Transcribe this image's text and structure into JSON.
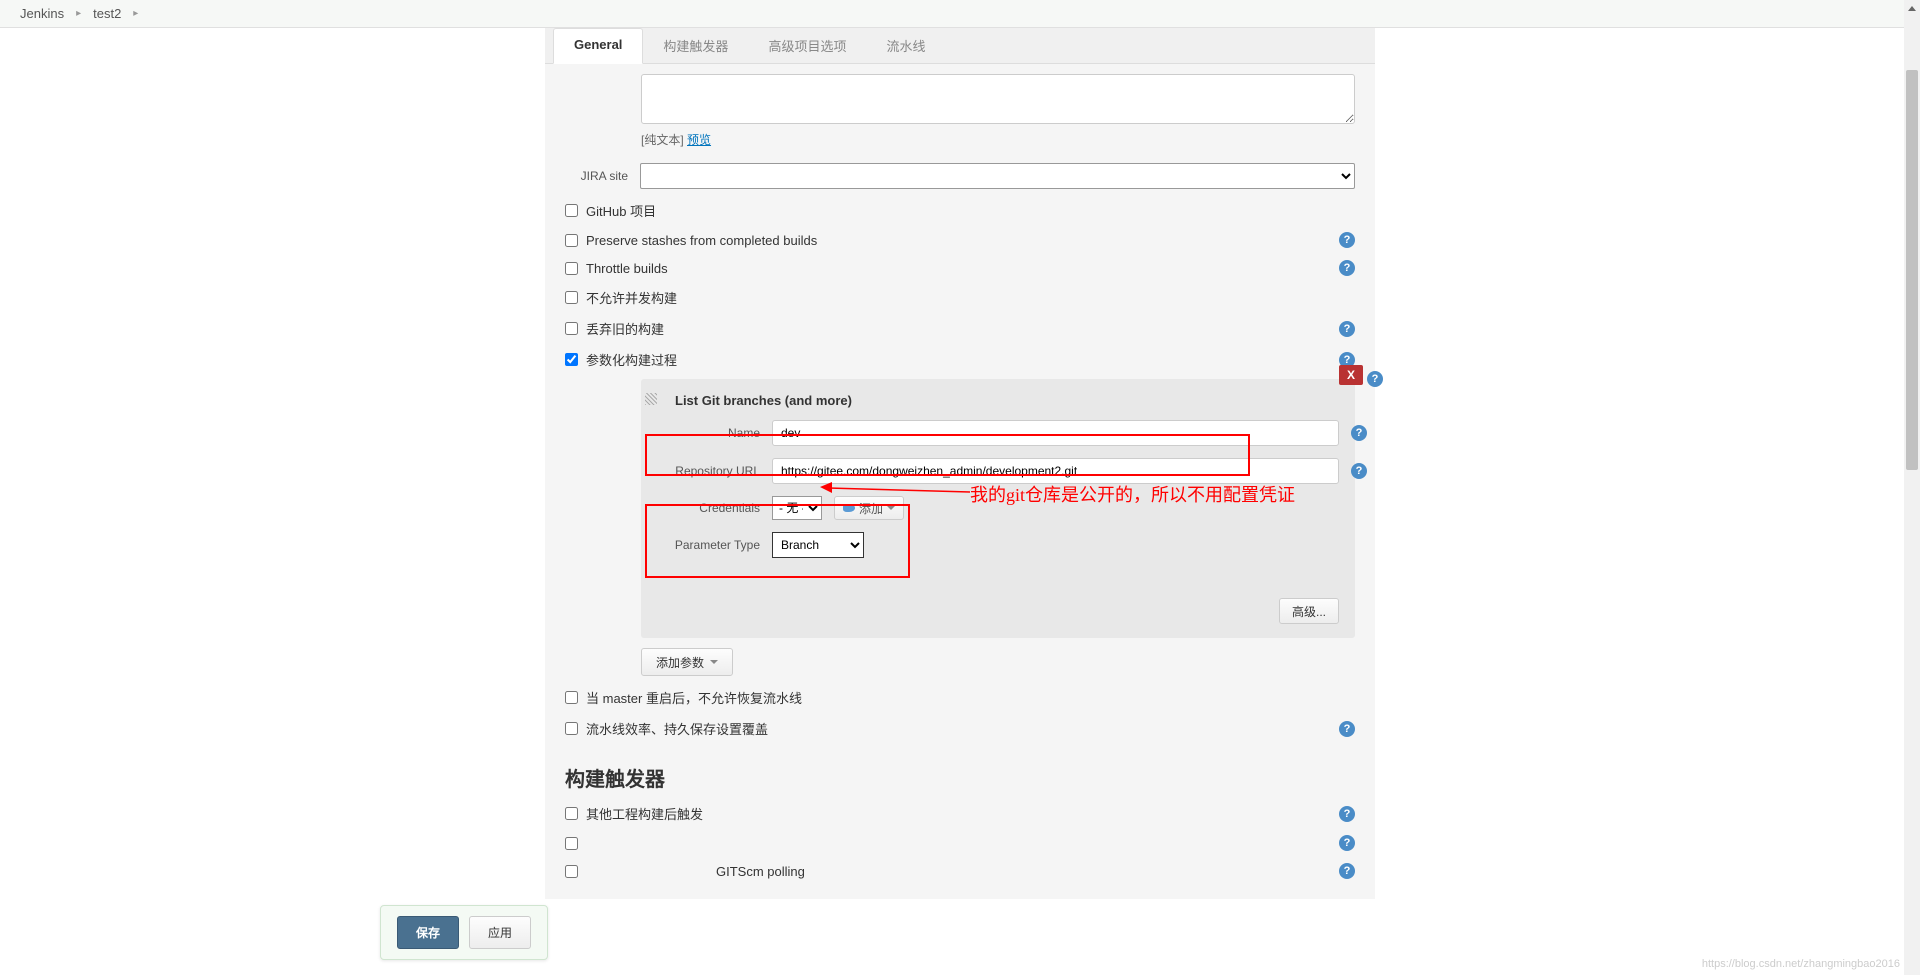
{
  "breadcrumb": {
    "item1": "Jenkins",
    "item2": "test2"
  },
  "tabs": {
    "general": "General",
    "triggers": "构建触发器",
    "advanced": "高级项目选项",
    "pipeline": "流水线"
  },
  "desc": {
    "plain_label": "[纯文本]",
    "preview_link": "预览"
  },
  "jira": {
    "label": "JIRA site"
  },
  "checkboxes": {
    "github": "GitHub 项目",
    "preserve": "Preserve stashes from completed builds",
    "throttle": "Throttle builds",
    "concurrent": "不允许并发构建",
    "discard": "丢弃旧的构建",
    "param": "参数化构建过程",
    "restart": "当 master 重启后，不允许恢复流水线",
    "durability": "流水线效率、持久保存设置覆盖"
  },
  "param_panel": {
    "title": "List Git branches (and more)",
    "name_label": "Name",
    "name_value": "dev",
    "repo_label": "Repository URL",
    "repo_value": "https://gitee.com/dongweizhen_admin/development2.git",
    "cred_label": "Credentials",
    "cred_value": "- 无 -",
    "add_cred": "添加",
    "type_label": "Parameter Type",
    "type_value": "Branch",
    "advanced": "高级...",
    "delete": "X"
  },
  "add_param": "添加参数",
  "section2": {
    "title": "构建触发器"
  },
  "triggers": {
    "other": "其他工程构建后触发",
    "gitscm": "GITScm polling"
  },
  "buttons": {
    "save": "保存",
    "apply": "应用"
  },
  "annotation": {
    "text": "我的git仓库是公开的，所以不用配置凭证"
  },
  "watermark": "https://blog.csdn.net/zhangmingbao2016"
}
